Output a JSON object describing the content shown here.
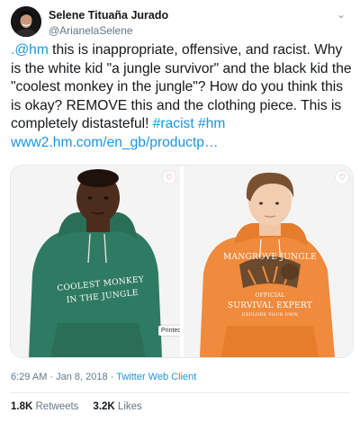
{
  "author": {
    "name": "Selene Tituaña Jurado",
    "handle": "@ArianelaSelene"
  },
  "tweet": {
    "mention": ".@hm",
    "text_main": " this is inappropriate, offensive, and racist. Why is the white kid \"a jungle survivor\" and the black kid the \"coolest monkey in the jungle\"? How do you think this is okay? REMOVE this and the clothing piece. This is completely distasteful! ",
    "hashtag_racist": "#racist",
    "hashtag_hm": "#hm",
    "url": "www2.hm.com/en_gb/productp…"
  },
  "media": {
    "left_hoodie_line1": "COOLEST MONKEY",
    "left_hoodie_line2": "IN THE JUNGLE",
    "right_hoodie_line1": "MANGROVE JUNGLE",
    "right_hoodie_line2": "OFFICIAL",
    "right_hoodie_line3": "SURVIVAL EXPERT",
    "right_hoodie_line4": "EXPLORE YOUR OWN",
    "printed_tag": "Printed",
    "heart_icon_left": "heart-outline",
    "heart_icon_right": "heart-outline"
  },
  "meta": {
    "time": "6:29 AM",
    "separator": " · ",
    "date": "Jan 8, 2018",
    "separator2": " · ",
    "source": "Twitter Web Client"
  },
  "stats": {
    "retweets_count": "1.8K",
    "retweets_label": "Retweets",
    "likes_count": "3.2K",
    "likes_label": "Likes"
  },
  "colors": {
    "link": "#1b95e0",
    "green_hoodie": "#2f7a62",
    "orange_hoodie": "#f08a3c"
  }
}
